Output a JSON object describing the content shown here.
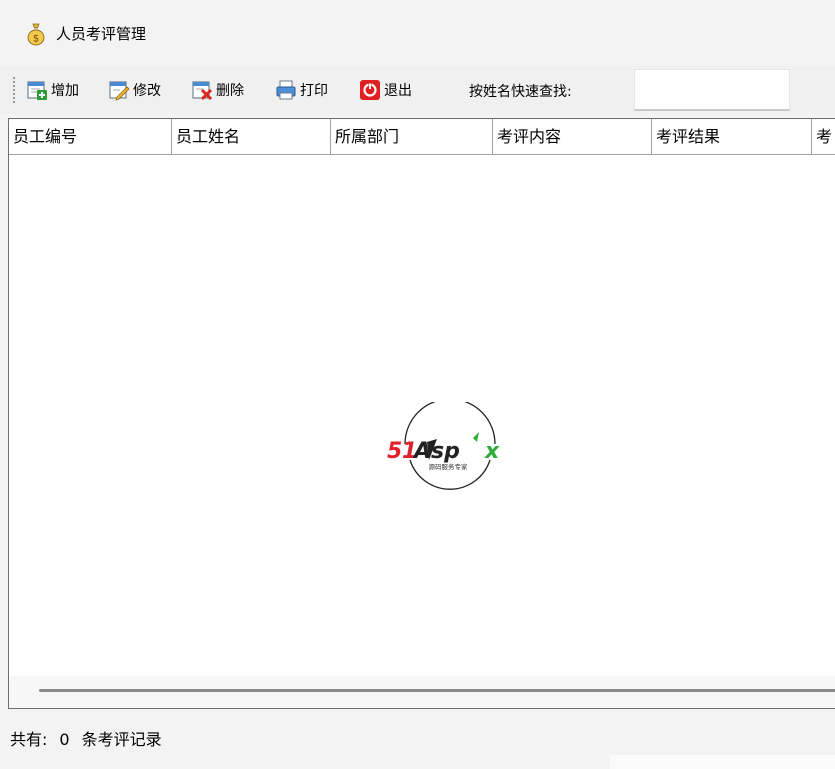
{
  "window": {
    "title": "人员考评管理"
  },
  "toolbar": {
    "add": "增加",
    "edit": "修改",
    "delete": "删除",
    "print": "打印",
    "exit": "退出",
    "search_label": "按姓名快速查找:",
    "search_value": ""
  },
  "grid": {
    "columns": [
      "员工编号",
      "员工姓名",
      "所属部门",
      "考评内容",
      "考评结果",
      "考"
    ],
    "rows": []
  },
  "watermark": {
    "brand": "51Aspx",
    "tagline": "源码服务专家"
  },
  "status": {
    "prefix": "共有:",
    "count": "0",
    "suffix": "条考评记录"
  },
  "icons": {
    "title": "money-bag-icon",
    "add": "add-document-icon",
    "edit": "edit-document-icon",
    "delete": "delete-document-icon",
    "print": "printer-icon",
    "exit": "exit-icon"
  },
  "colors": {
    "delete_red": "#d9261c",
    "exit_red": "#e02020",
    "brand_red": "#e0202a",
    "brand_green": "#2fae3a"
  }
}
